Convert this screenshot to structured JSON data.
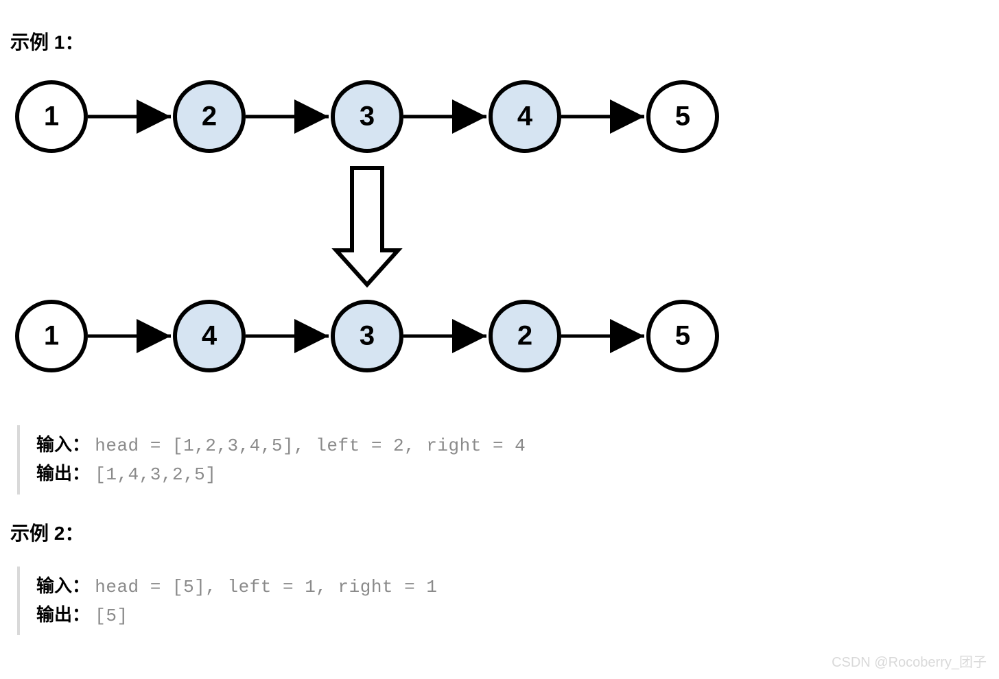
{
  "example1": {
    "title": "示例 1：",
    "list_before": [
      "1",
      "2",
      "3",
      "4",
      "5"
    ],
    "list_after": [
      "1",
      "4",
      "3",
      "2",
      "5"
    ],
    "highlighted_indices_before": [
      1,
      2,
      3
    ],
    "highlighted_indices_after": [
      1,
      2,
      3
    ],
    "io": {
      "input_label": "输入：",
      "input_value": "head = [1,2,3,4,5], left = 2, right = 4",
      "output_label": "输出：",
      "output_value": "[1,4,3,2,5]"
    }
  },
  "example2": {
    "title": "示例 2：",
    "io": {
      "input_label": "输入：",
      "input_value": "head = [5], left = 1, right = 1",
      "output_label": "输出：",
      "output_value": "[5]"
    }
  },
  "colors": {
    "node_fill_plain": "#ffffff",
    "node_fill_highlight": "#d6e4f2",
    "node_stroke": "#000000",
    "arrow_stroke": "#000000"
  },
  "watermark": "CSDN @Rocoberry_团子"
}
